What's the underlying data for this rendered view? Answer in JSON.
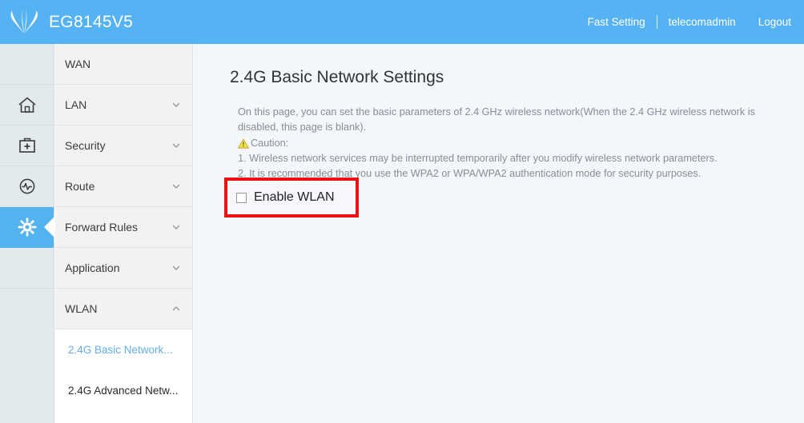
{
  "header": {
    "brand_name": "EG8145V5",
    "logo_icon": "huawei-flower-logo",
    "fast_setting": "Fast Setting",
    "user_name": "telecomadmin",
    "logout": "Logout"
  },
  "icon_rail": {
    "items": [
      {
        "name": "home",
        "icon": "home-icon",
        "active": false
      },
      {
        "name": "toolbox",
        "icon": "first-aid-kit-icon",
        "active": false
      },
      {
        "name": "diagnostics",
        "icon": "pulse-circle-icon",
        "active": false
      },
      {
        "name": "settings",
        "icon": "gear-icon",
        "active": true
      }
    ]
  },
  "sidebar": {
    "items": [
      {
        "label": "WAN",
        "chevron": "none"
      },
      {
        "label": "LAN",
        "chevron": "down"
      },
      {
        "label": "Security",
        "chevron": "down"
      },
      {
        "label": "Route",
        "chevron": "down"
      },
      {
        "label": "Forward Rules",
        "chevron": "down"
      },
      {
        "label": "Application",
        "chevron": "down"
      },
      {
        "label": "WLAN",
        "chevron": "up"
      }
    ],
    "submenu": [
      {
        "label": "2.4G Basic Network...",
        "active": true
      },
      {
        "label": "2.4G Advanced Netw...",
        "active": false
      }
    ]
  },
  "main": {
    "title": "2.4G Basic Network Settings",
    "intro_line1": "On this page, you can set the basic parameters of 2.4 GHz wireless network(When the 2.4 GHz wireless network is disabled, this page is blank).",
    "caution_label": "Caution:",
    "caution_icon": "warning-triangle-icon",
    "caution_1": "1. Wireless network services may be interrupted temporarily after you modify wireless network parameters.",
    "caution_2": "2. It is recommended that you use the WPA2 or WPA/WPA2 authentication mode for security purposes.",
    "enable_wlan_label": "Enable WLAN",
    "enable_wlan_checked": false
  },
  "colors": {
    "header_blue": "#55b2f3",
    "rail_active_blue": "#52b3ee",
    "highlight_red": "#ee1111",
    "active_link_blue": "#63aee8",
    "content_bg": "#f3f6fb"
  }
}
